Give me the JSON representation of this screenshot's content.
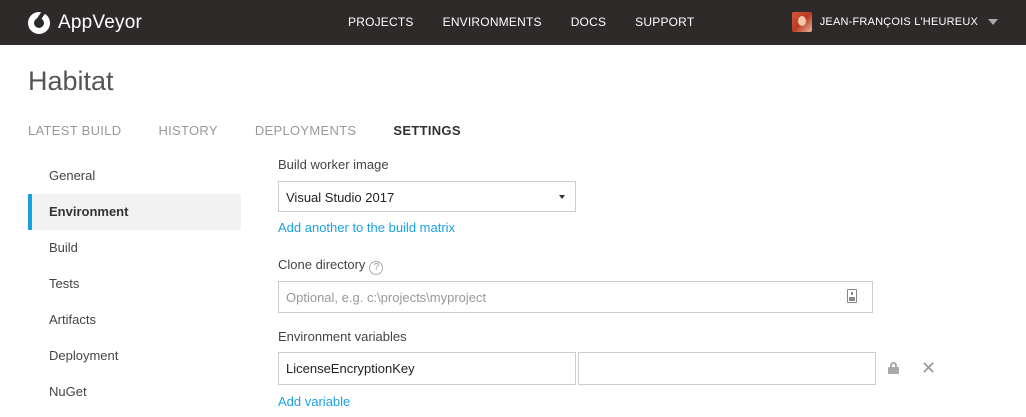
{
  "brand": {
    "name": "AppVeyor",
    "nav_bg": "#2e2a2a",
    "accent": "#1ba1e2"
  },
  "nav": {
    "items": [
      "PROJECTS",
      "ENVIRONMENTS",
      "DOCS",
      "SUPPORT"
    ],
    "user_name": "JEAN-FRANÇOIS L'HEUREUX"
  },
  "project": {
    "title": "Habitat"
  },
  "tabs": [
    {
      "label": "LATEST BUILD",
      "active": false
    },
    {
      "label": "HISTORY",
      "active": false
    },
    {
      "label": "DEPLOYMENTS",
      "active": false
    },
    {
      "label": "SETTINGS",
      "active": true
    }
  ],
  "sidebar": {
    "items": [
      {
        "label": "General",
        "active": false
      },
      {
        "label": "Environment",
        "active": true
      },
      {
        "label": "Build",
        "active": false
      },
      {
        "label": "Tests",
        "active": false
      },
      {
        "label": "Artifacts",
        "active": false
      },
      {
        "label": "Deployment",
        "active": false
      },
      {
        "label": "NuGet",
        "active": false
      }
    ]
  },
  "settings": {
    "build_worker_image": {
      "label": "Build worker image",
      "value": "Visual Studio 2017",
      "add_link": "Add another to the build matrix"
    },
    "clone_directory": {
      "label": "Clone directory",
      "help_glyph": "?",
      "placeholder": "Optional, e.g. c:\\projects\\myproject",
      "value": ""
    },
    "environment_variables": {
      "label": "Environment variables",
      "rows": [
        {
          "name": "LicenseEncryptionKey",
          "value": ""
        }
      ],
      "add_link": "Add variable"
    }
  },
  "icons": {
    "logo": "appveyor-logo-icon",
    "caret": "chevron-down-icon",
    "help": "help-icon",
    "input_helper": "variable-insert-icon",
    "lock": "lock-icon",
    "remove": "close-icon"
  }
}
